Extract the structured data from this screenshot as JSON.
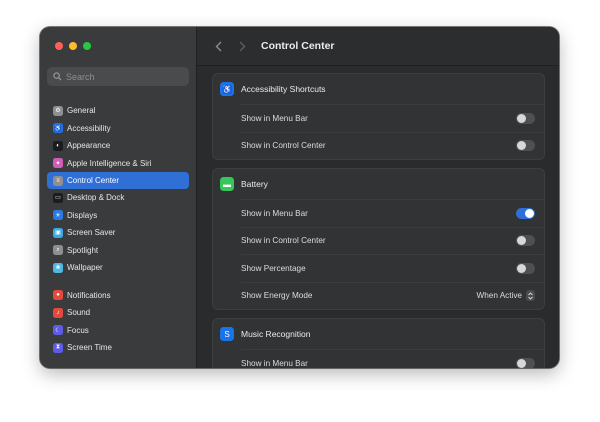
{
  "window": {
    "title": "Control Center"
  },
  "colors": {
    "accent": "#2f6fd6",
    "close": "#ff5f57",
    "minimize": "#febc2e",
    "zoom": "#28c840"
  },
  "search": {
    "placeholder": "Search"
  },
  "sidebar": {
    "groups": [
      [
        {
          "label": "General",
          "icon": "gear-icon",
          "color": "#8e8e93",
          "active": false
        },
        {
          "label": "Accessibility",
          "icon": "accessibility-icon",
          "color": "#1a73e8",
          "active": false
        },
        {
          "label": "Appearance",
          "icon": "appearance-icon",
          "color": "#1c1c1e",
          "active": false
        },
        {
          "label": "Apple Intelligence & Siri",
          "icon": "siri-icon",
          "color": "#d05cb8",
          "active": false
        },
        {
          "label": "Control Center",
          "icon": "control-center-icon",
          "color": "#8e8e93",
          "active": true
        },
        {
          "label": "Desktop & Dock",
          "icon": "dock-icon",
          "color": "#1c1c1e",
          "active": false
        },
        {
          "label": "Displays",
          "icon": "displays-icon",
          "color": "#2a7ae2",
          "active": false
        },
        {
          "label": "Screen Saver",
          "icon": "screen-saver-icon",
          "color": "#3ca8e6",
          "active": false
        },
        {
          "label": "Spotlight",
          "icon": "spotlight-icon",
          "color": "#8e8e93",
          "active": false
        },
        {
          "label": "Wallpaper",
          "icon": "wallpaper-icon",
          "color": "#4fb6e8",
          "active": false
        }
      ],
      [
        {
          "label": "Notifications",
          "icon": "notifications-icon",
          "color": "#e5483c",
          "active": false
        },
        {
          "label": "Sound",
          "icon": "sound-icon",
          "color": "#e5483c",
          "active": false
        },
        {
          "label": "Focus",
          "icon": "focus-icon",
          "color": "#5e5ce6",
          "active": false
        },
        {
          "label": "Screen Time",
          "icon": "screen-time-icon",
          "color": "#5e5ce6",
          "active": false
        }
      ]
    ]
  },
  "sections": [
    {
      "title": "Accessibility Shortcuts",
      "icon": "accessibility-icon",
      "color": "#1a73e8",
      "rows": [
        {
          "label": "Show in Menu Bar",
          "type": "toggle",
          "on": false
        },
        {
          "label": "Show in Control Center",
          "type": "toggle",
          "on": false
        }
      ]
    },
    {
      "title": "Battery",
      "icon": "battery-icon",
      "color": "#34c759",
      "rows": [
        {
          "label": "Show in Menu Bar",
          "type": "toggle",
          "on": true
        },
        {
          "label": "Show in Control Center",
          "type": "toggle",
          "on": false
        },
        {
          "label": "Show Percentage",
          "type": "toggle",
          "on": false
        },
        {
          "label": "Show Energy Mode",
          "type": "select",
          "value": "When Active"
        }
      ]
    },
    {
      "title": "Music Recognition",
      "icon": "shazam-icon",
      "color": "#1a73e8",
      "rows": [
        {
          "label": "Show in Menu Bar",
          "type": "toggle",
          "on": false
        }
      ]
    }
  ]
}
